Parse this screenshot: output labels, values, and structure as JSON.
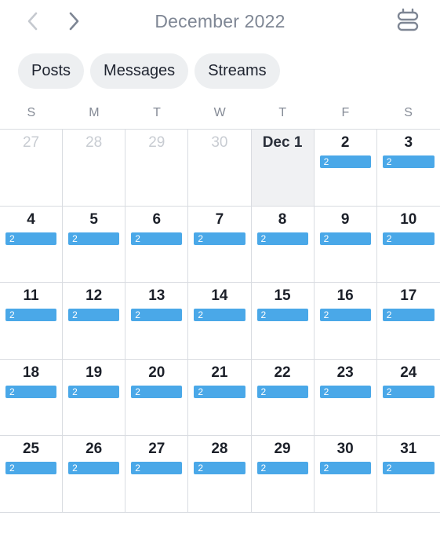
{
  "header": {
    "title": "December 2022",
    "prev_icon": "chevron-left-icon",
    "next_icon": "chevron-right-icon",
    "toggle_icon": "calendar-view-icon"
  },
  "filters": [
    "Posts",
    "Messages",
    "Streams"
  ],
  "weekdays": [
    "S",
    "M",
    "T",
    "W",
    "T",
    "F",
    "S"
  ],
  "colors": {
    "badge": "#4aa8e8",
    "today_bg": "#f0f1f3",
    "muted_text": "#c8ccd2"
  },
  "days": [
    {
      "label": "27",
      "muted": true
    },
    {
      "label": "28",
      "muted": true
    },
    {
      "label": "29",
      "muted": true
    },
    {
      "label": "30",
      "muted": true
    },
    {
      "label": "Dec 1",
      "today": true
    },
    {
      "label": "2",
      "count": "2"
    },
    {
      "label": "3",
      "count": "2"
    },
    {
      "label": "4",
      "count": "2"
    },
    {
      "label": "5",
      "count": "2"
    },
    {
      "label": "6",
      "count": "2"
    },
    {
      "label": "7",
      "count": "2"
    },
    {
      "label": "8",
      "count": "2"
    },
    {
      "label": "9",
      "count": "2"
    },
    {
      "label": "10",
      "count": "2"
    },
    {
      "label": "11",
      "count": "2"
    },
    {
      "label": "12",
      "count": "2"
    },
    {
      "label": "13",
      "count": "2"
    },
    {
      "label": "14",
      "count": "2"
    },
    {
      "label": "15",
      "count": "2"
    },
    {
      "label": "16",
      "count": "2"
    },
    {
      "label": "17",
      "count": "2"
    },
    {
      "label": "18",
      "count": "2"
    },
    {
      "label": "19",
      "count": "2"
    },
    {
      "label": "20",
      "count": "2"
    },
    {
      "label": "21",
      "count": "2"
    },
    {
      "label": "22",
      "count": "2"
    },
    {
      "label": "23",
      "count": "2"
    },
    {
      "label": "24",
      "count": "2"
    },
    {
      "label": "25",
      "count": "2"
    },
    {
      "label": "26",
      "count": "2"
    },
    {
      "label": "27",
      "count": "2"
    },
    {
      "label": "28",
      "count": "2"
    },
    {
      "label": "29",
      "count": "2"
    },
    {
      "label": "30",
      "count": "2"
    },
    {
      "label": "31",
      "count": "2"
    }
  ]
}
